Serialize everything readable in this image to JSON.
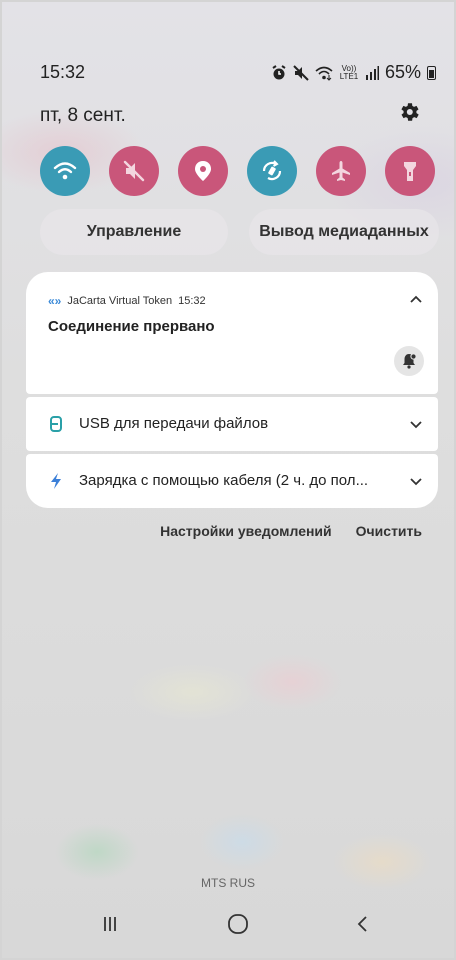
{
  "status_bar": {
    "time": "15:32",
    "battery_percent": "65%",
    "icons": [
      "alarm-icon",
      "mute-icon",
      "wifi-icon",
      "volte-icon",
      "signal-icon",
      "battery-icon"
    ],
    "volte_label": "Vo)) LTE1"
  },
  "date": "пт, 8 сент.",
  "quick_toggles": [
    {
      "name": "wifi",
      "icon": "wifi-icon",
      "active": true,
      "color": "#3a9bb5"
    },
    {
      "name": "sound",
      "icon": "mute-icon",
      "active": true,
      "color": "#c9567a"
    },
    {
      "name": "location",
      "icon": "location-icon",
      "active": true,
      "color": "#c9567a"
    },
    {
      "name": "auto-rotate",
      "icon": "rotate-icon",
      "active": true,
      "color": "#3a9bb5"
    },
    {
      "name": "airplane",
      "icon": "airplane-icon",
      "active": true,
      "color": "#c9567a"
    },
    {
      "name": "flashlight",
      "icon": "flashlight-icon",
      "active": true,
      "color": "#c9567a"
    }
  ],
  "buttons": {
    "device_control": "Управление",
    "media_output": "Вывод медиаданных"
  },
  "notifications": [
    {
      "app": "JaCarta Virtual Token",
      "time": "15:32",
      "title": "Соединение прервано"
    },
    {
      "text": "USB для передачи файлов"
    },
    {
      "text": "Зарядка с помощью кабеля (2 ч. до пол..."
    }
  ],
  "actions": {
    "settings": "Настройки уведомлений",
    "clear": "Очистить"
  },
  "carrier": "MTS RUS",
  "colors": {
    "active_blue": "#3a9bb5",
    "active_pink": "#c9567a",
    "usb_teal": "#2aa0a8",
    "charge_blue": "#3b7fd8"
  }
}
